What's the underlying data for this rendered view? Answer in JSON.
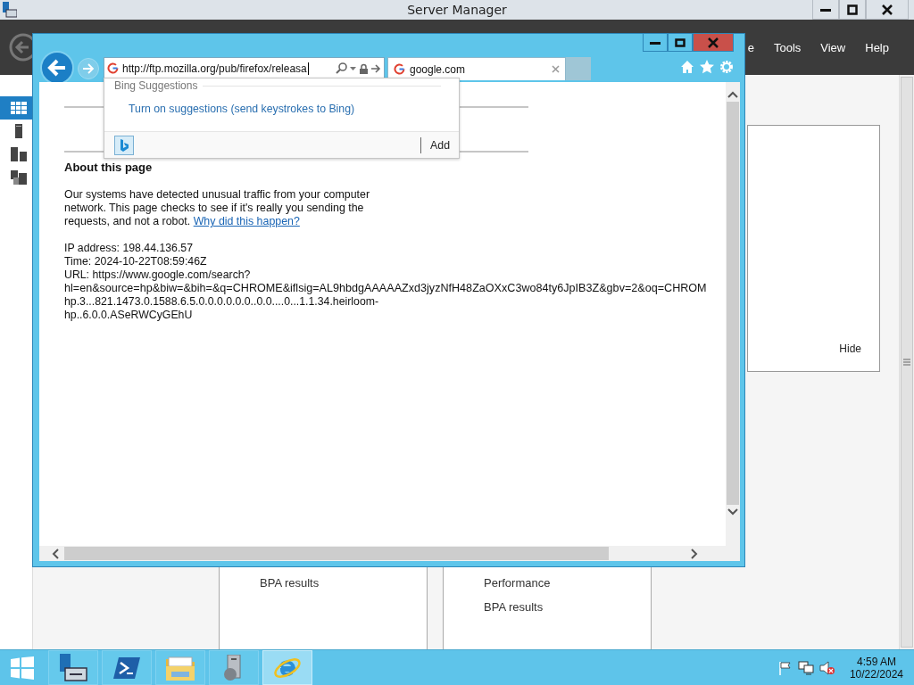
{
  "server_manager": {
    "title": "Server Manager",
    "menu": [
      "e",
      "Tools",
      "View",
      "Help"
    ],
    "sidebar": [
      {
        "kind": "dashboard",
        "selected": true
      },
      {
        "kind": "server",
        "selected": false
      },
      {
        "kind": "servers",
        "selected": false
      },
      {
        "kind": "roles",
        "selected": false
      }
    ],
    "panel": {
      "button": "Hide"
    },
    "tiles": [
      {
        "items": [
          "BPA results"
        ]
      },
      {
        "items": [
          "Performance",
          "BPA results"
        ]
      }
    ]
  },
  "browser": {
    "address": "http://ftp.mozilla.org/pub/firefox/releasa",
    "tabs": [
      {
        "label": "google.com",
        "selected": true
      }
    ],
    "suggestions": {
      "heading": "Bing Suggestions",
      "link": "Turn on suggestions (send keystrokes to Bing)",
      "add": "Add"
    },
    "page": {
      "heading": "About this page",
      "paragraph": "Our systems have detected unusual traffic from your computer network. This page checks to see if it's really you sending the requests, and not a robot.",
      "link": "Why did this happen?",
      "details": [
        "IP address: 198.44.136.57",
        "Time: 2024-10-22T08:59:46Z",
        "URL: https://www.google.com/search?",
        "hl=en&source=hp&biw=&bih=&q=CHROME&iflsig=AL9hbdgAAAAAZxd3jyzNfH48ZaOXxC3wo84ty6JpIB3Z&gbv=2&oq=CHROM",
        "hp.3...821.1473.0.1588.6.5.0.0.0.0.0.0..0.0....0...1.1.34.heirloom-",
        "hp..6.0.0.ASeRWCyGEhU"
      ]
    }
  },
  "taskbar": {
    "apps": [
      {
        "kind": "server-manager",
        "selected": false
      },
      {
        "kind": "powershell",
        "selected": false
      },
      {
        "kind": "explorer",
        "selected": false
      },
      {
        "kind": "tools",
        "selected": false
      },
      {
        "kind": "browser",
        "selected": true
      }
    ],
    "time": "4:59 AM",
    "date": "10/22/2024"
  }
}
